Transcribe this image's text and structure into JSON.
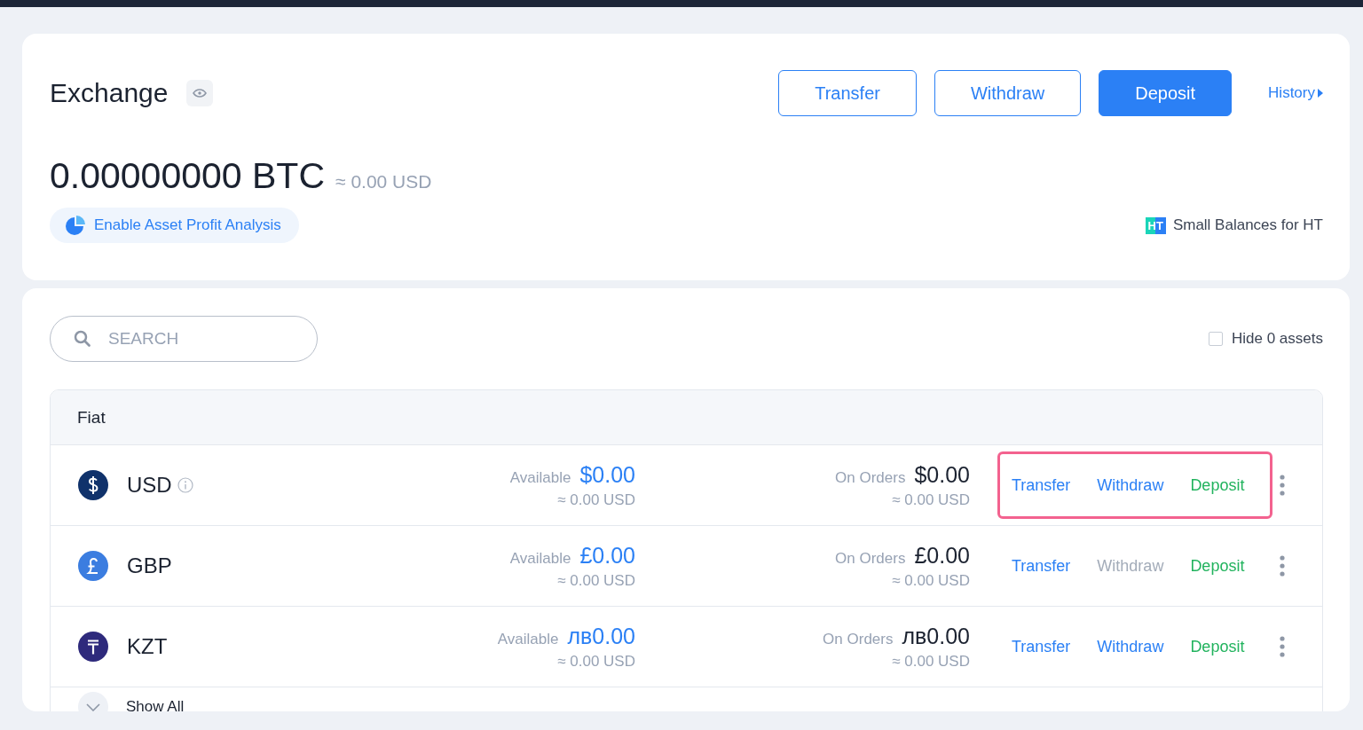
{
  "account": {
    "title": "Exchange",
    "actions": [
      {
        "label": "Transfer",
        "primary": false
      },
      {
        "label": "Withdraw",
        "primary": false
      },
      {
        "label": "Deposit",
        "primary": true
      }
    ],
    "history_link": "History",
    "balance": "0.00000000 BTC",
    "balance_estimate": "≈ 0.00 USD",
    "profit_analysis_button": "Enable Asset Profit Analysis",
    "small_balances_badge": "HT",
    "small_balances_link": "Small Balances for HT"
  },
  "assets": {
    "search": {
      "placeholder": "SEARCH"
    },
    "hide_zero": {
      "label": "Hide 0 assets",
      "checked": false
    },
    "group": {
      "title": "Fiat",
      "rows": [
        {
          "kind": "dollar",
          "currency": "USD",
          "info": true,
          "available_label": "Available",
          "available": "$0.00",
          "available_estimate": "≈ 0.00 USD",
          "orders_label": "On Orders",
          "orders": "$0.00",
          "orders_estimate": "≈ 0.00 USD",
          "transfer": "Transfer",
          "withdraw": "Withdraw",
          "withdraw_disabled": false,
          "deposit": "Deposit",
          "highlighted": true
        },
        {
          "kind": "pound",
          "currency": "GBP",
          "info": false,
          "available_label": "Available",
          "available": "£0.00",
          "available_estimate": "≈ 0.00 USD",
          "orders_label": "On Orders",
          "orders": "£0.00",
          "orders_estimate": "≈ 0.00 USD",
          "transfer": "Transfer",
          "withdraw": "Withdraw",
          "withdraw_disabled": true,
          "deposit": "Deposit",
          "highlighted": false
        },
        {
          "kind": "tenge",
          "currency": "KZT",
          "info": false,
          "available_label": "Available",
          "available": "лв0.00",
          "available_estimate": "≈ 0.00 USD",
          "orders_label": "On Orders",
          "orders": "лв0.00",
          "orders_estimate": "≈ 0.00 USD",
          "transfer": "Transfer",
          "withdraw": "Withdraw",
          "withdraw_disabled": false,
          "deposit": "Deposit",
          "highlighted": false
        }
      ],
      "show_all": "Show All"
    }
  }
}
